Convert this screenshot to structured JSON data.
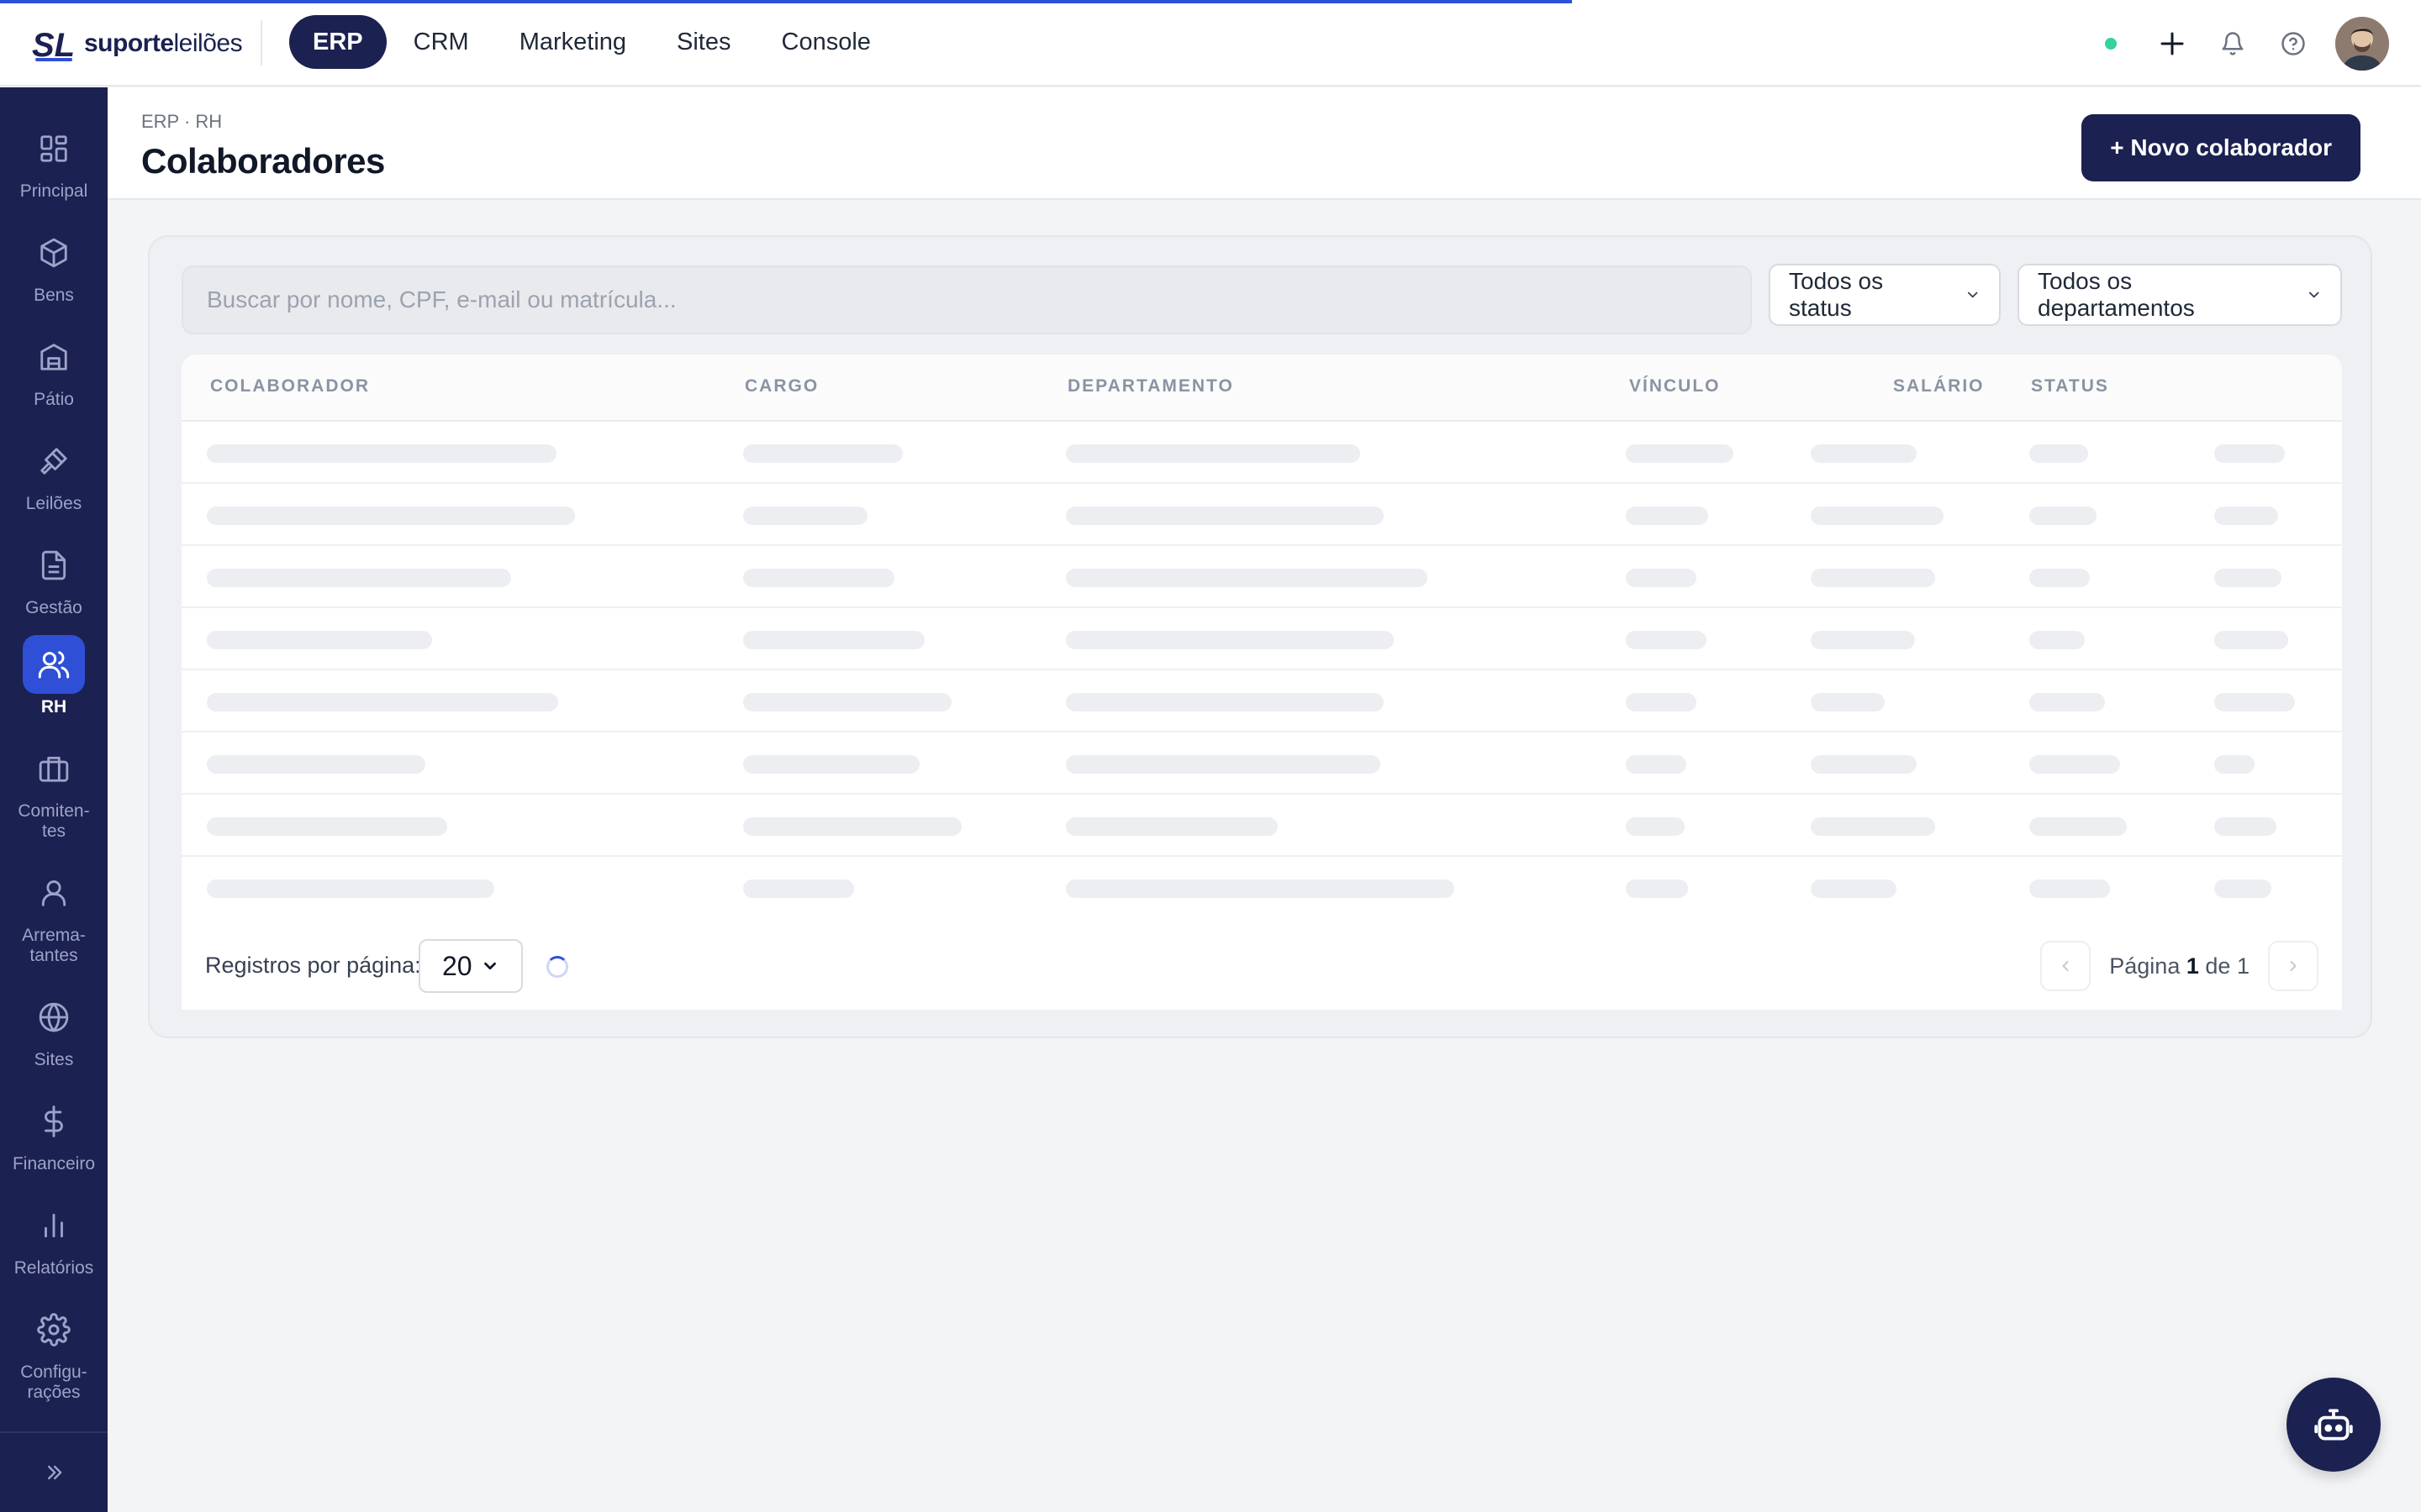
{
  "app": {
    "logo_strong": "suporte",
    "logo_light": "leilões"
  },
  "topnav": {
    "tabs": [
      {
        "label": "ERP",
        "active": true
      },
      {
        "label": "CRM",
        "active": false
      },
      {
        "label": "Marketing",
        "active": false
      },
      {
        "label": "Sites",
        "active": false
      },
      {
        "label": "Console",
        "active": false
      }
    ],
    "icons": [
      "status-online-dot",
      "plus-icon",
      "bell-icon",
      "help-circle-icon",
      "user-avatar"
    ]
  },
  "sidebar": {
    "items": [
      {
        "label": "Principal",
        "icon": "grid-icon"
      },
      {
        "label": "Bens",
        "icon": "box-icon"
      },
      {
        "label": "Pátio",
        "icon": "building-icon"
      },
      {
        "label": "Leilões",
        "icon": "gavel-icon"
      },
      {
        "label": "Gestão",
        "icon": "document-icon"
      },
      {
        "label": "RH",
        "icon": "users-icon",
        "active": true
      },
      {
        "label": "Comiten-\ntes",
        "icon": "briefcase-icon"
      },
      {
        "label": "Arrema-\ntantes",
        "icon": "user-icon"
      },
      {
        "label": "Sites",
        "icon": "globe-icon"
      },
      {
        "label": "Financeiro",
        "icon": "dollar-icon"
      },
      {
        "label": "Relatórios",
        "icon": "bar-chart-icon"
      },
      {
        "label": "Configu-\nrações",
        "icon": "gear-icon"
      }
    ],
    "expand_icon": "chevrons-right-icon"
  },
  "page": {
    "breadcrumb": "ERP · RH",
    "title": "Colaboradores",
    "new_button": "+ Novo colaborador"
  },
  "filters": {
    "search_placeholder": "Buscar por nome, CPF, e-mail ou matrícula...",
    "status_select": "Todos os status",
    "department_select": "Todos os departamentos"
  },
  "table": {
    "columns": [
      "COLABORADOR",
      "CARGO",
      "DEPARTAMENTO",
      "VÍNCULO",
      "SALÁRIO",
      "STATUS"
    ],
    "loading": true,
    "skeleton_rows": 8
  },
  "pagination": {
    "per_page_label": "Registros por página:",
    "per_page_value": "20",
    "page_word": "Página",
    "current_page": "1",
    "of_word": "de",
    "total_pages": "1"
  },
  "colors": {
    "navy": "#1b2150",
    "accent": "#2f4fd6",
    "online": "#34d399"
  },
  "fab": {
    "icon": "robot-icon"
  }
}
